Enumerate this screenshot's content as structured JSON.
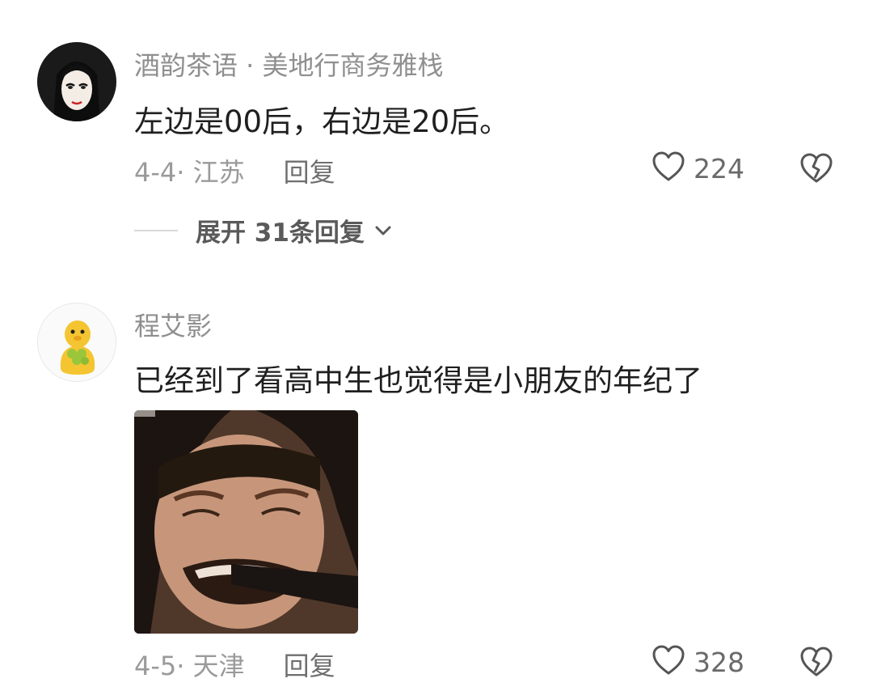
{
  "comments": [
    {
      "author": "酒韵茶语 · 美地行商务雅栈",
      "text": "左边是00后，右边是20后。",
      "date_location": "4-4· 江苏",
      "reply_label": "回复",
      "likes": "224",
      "expand_label": "展开 31条回复",
      "avatar_icon": "anime-girl-avatar"
    },
    {
      "author": "程艾影",
      "text": "已经到了看高中生也觉得是小朋友的年纪了",
      "date_location": "4-5· 天津",
      "reply_label": "回复",
      "likes": "328",
      "avatar_icon": "yellow-duck-avatar",
      "image_icon": "crying-man-meme"
    }
  ],
  "colors": {
    "meta": "#9a9a9a",
    "author": "#8f8f8f",
    "text": "#1f1f1f"
  }
}
